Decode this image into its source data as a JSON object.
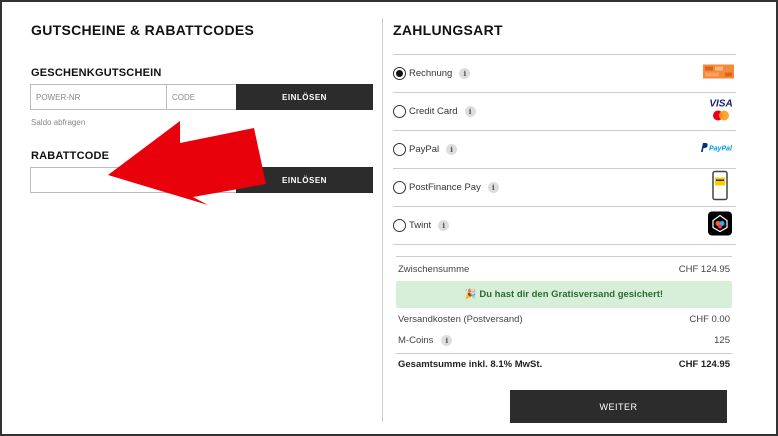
{
  "left": {
    "title": "GUTSCHEINE & RABATTCODES",
    "gift": {
      "heading": "GESCHENKGUTSCHEIN",
      "power_placeholder": "POWER-NR",
      "code_placeholder": "CODE",
      "redeem_label": "EINLÖSEN",
      "balance_link": "Saldo abfragen"
    },
    "discount": {
      "heading": "RABATTCODE",
      "value": "",
      "redeem_label": "EINLÖSEN"
    }
  },
  "right": {
    "title": "ZAHLUNGSART",
    "methods": [
      {
        "label": "Rechnung",
        "selected": true,
        "logo": "invoice-logo"
      },
      {
        "label": "Credit Card",
        "selected": false,
        "logo": "visa-mastercard-logo"
      },
      {
        "label": "PayPal",
        "selected": false,
        "logo": "paypal-logo"
      },
      {
        "label": "PostFinance Pay",
        "selected": false,
        "logo": "postfinance-phone-logo"
      },
      {
        "label": "Twint",
        "selected": false,
        "logo": "twint-logo"
      }
    ],
    "info_glyph": "i",
    "logos": {
      "visa": "VISA",
      "paypal": "PayPal"
    },
    "summary": {
      "subtotal_label": "Zwischensumme",
      "subtotal_value": "CHF 124.95",
      "banner_text": "🎉 Du hast dir den Gratisversand gesichert!",
      "shipping_label": "Versandkosten (Postversand)",
      "shipping_value": "CHF 0.00",
      "mcoins_label": "M-Coins",
      "mcoins_value": "125",
      "total_label": "Gesamtsumme inkl. 8.1% MwSt.",
      "total_value": "CHF 124.95"
    },
    "continue_label": "WEITER"
  },
  "colors": {
    "button_dark": "#2c2c2c",
    "arrow_red": "#e8000b",
    "banner_bg": "#d7efd8",
    "banner_text": "#2f6b30"
  }
}
